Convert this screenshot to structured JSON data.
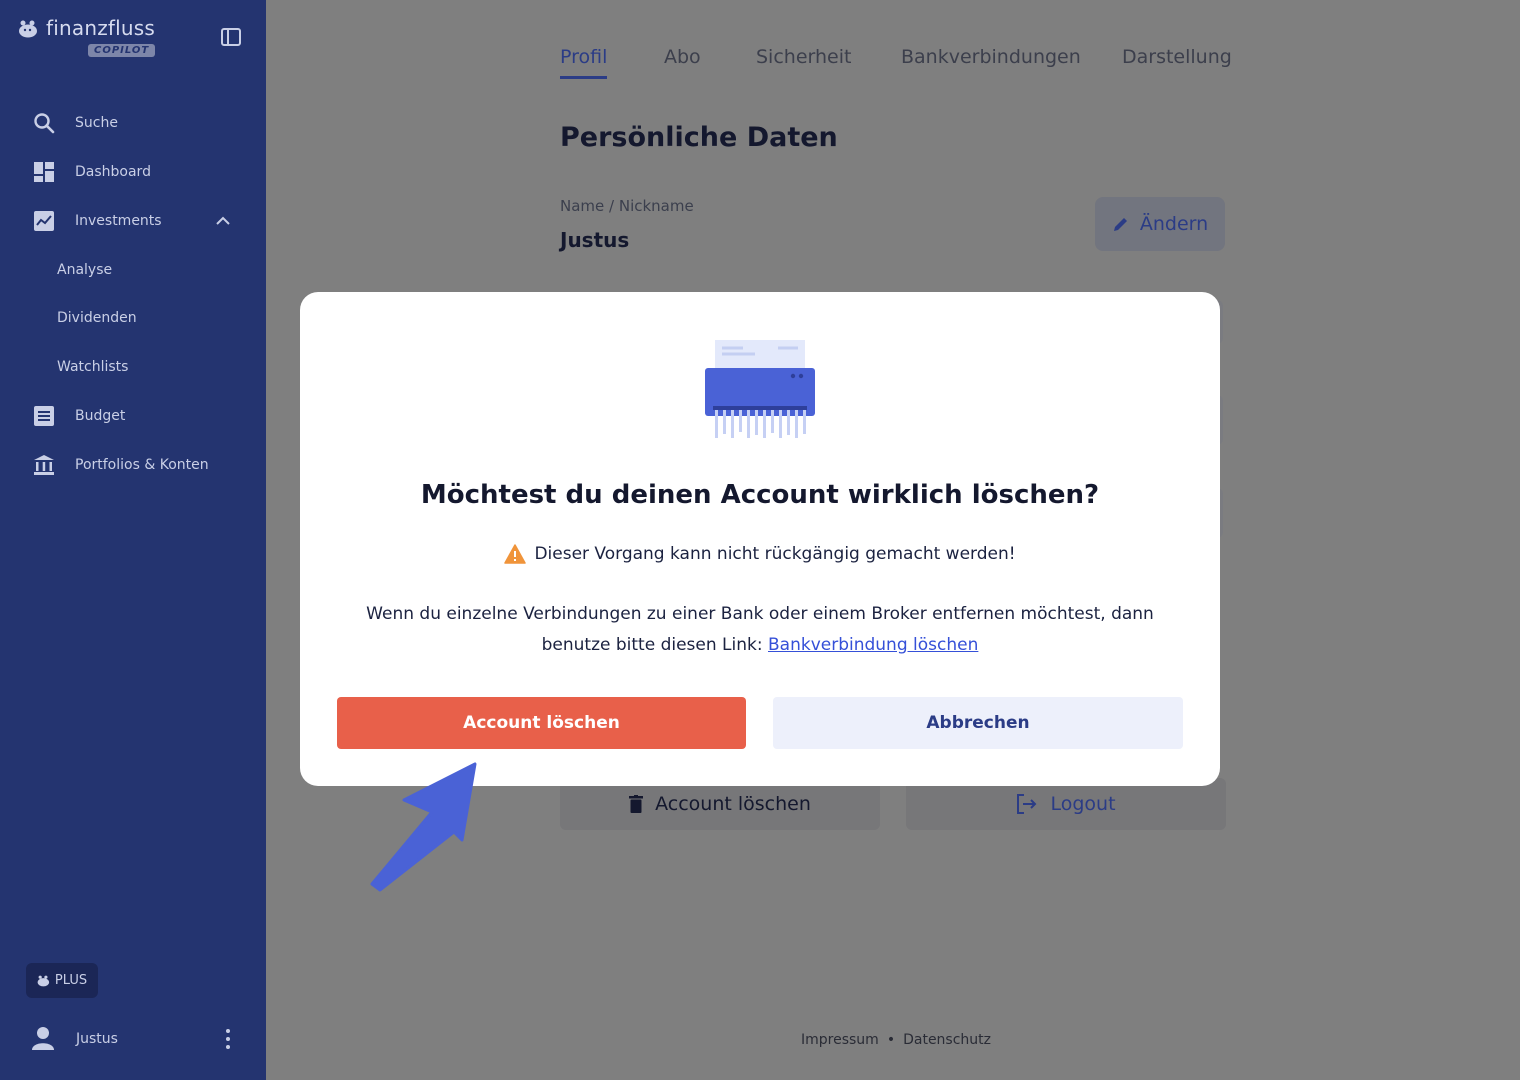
{
  "brand": {
    "name": "finanzfluss",
    "badge": "COPILOT"
  },
  "sidebar": {
    "items": [
      {
        "label": "Suche",
        "icon": "search-icon"
      },
      {
        "label": "Dashboard",
        "icon": "dashboard-icon"
      },
      {
        "label": "Investments",
        "icon": "chart-icon"
      },
      {
        "label": "Analyse"
      },
      {
        "label": "Dividenden"
      },
      {
        "label": "Watchlists"
      },
      {
        "label": "Budget",
        "icon": "list-icon"
      },
      {
        "label": "Portfolios & Konten",
        "icon": "bank-icon"
      }
    ],
    "plus_label": "PLUS",
    "user_name": "Justus"
  },
  "tabs": [
    {
      "label": "Profil",
      "active": true
    },
    {
      "label": "Abo"
    },
    {
      "label": "Sicherheit"
    },
    {
      "label": "Bankverbindungen"
    },
    {
      "label": "Darstellung"
    }
  ],
  "profile": {
    "section_title": "Persönliche Daten",
    "name_label": "Name / Nickname",
    "name_value": "Justus",
    "edit_label": "Ändern"
  },
  "actions": {
    "delete_account_label": "Account löschen",
    "logout_label": "Logout"
  },
  "footer": {
    "impressum": "Impressum",
    "separator": "•",
    "datenschutz": "Datenschutz"
  },
  "modal": {
    "title": "Möchtest du deinen Account wirklich löschen?",
    "warning": "Dieser Vorgang kann nicht rückgängig gemacht werden!",
    "text_line1": "Wenn du einzelne Verbindungen zu einer Bank oder einem Broker entfernen möchtest, dann",
    "text_line2": "benutze bitte diesen Link:",
    "link_label": "Bankverbindung löschen",
    "confirm_label": "Account löschen",
    "cancel_label": "Abbrechen"
  },
  "colors": {
    "sidebar": "#243470",
    "accent": "#2b3c86",
    "danger": "#e8604a",
    "link": "#3550d8",
    "warning": "#f0943a"
  }
}
